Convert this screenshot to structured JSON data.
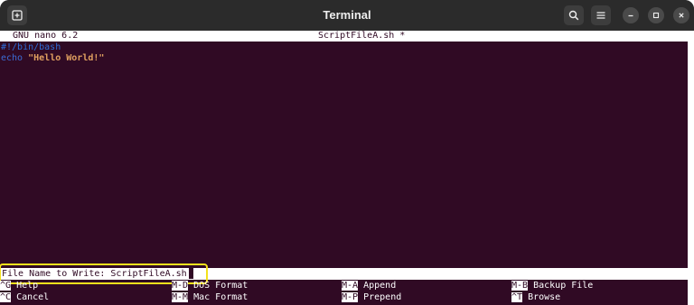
{
  "window": {
    "title": "Terminal"
  },
  "titlebar": {
    "new_tab_icon": "new-tab-icon",
    "search_icon": "search-icon",
    "menu_icon": "hamburger-menu-icon",
    "minimize_icon": "minimize-icon",
    "maximize_icon": "maximize-icon",
    "close_icon": "close-icon"
  },
  "nano": {
    "version": "GNU nano 6.2",
    "filename": "ScriptFileA.sh *",
    "lines": [
      {
        "text": "#!/bin/bash",
        "color": "#2f6ed8"
      },
      {
        "keyword": "echo",
        "keyword_color": "#3c6cd6",
        "string": "\"Hello World!\"",
        "string_color": "#e0a060"
      }
    ],
    "prompt_label": "File Name to Write: ScriptFileA.sh",
    "shortcuts": [
      {
        "key": "^G",
        "label": "Help"
      },
      {
        "key": "M-D",
        "label": "DOS Format"
      },
      {
        "key": "M-A",
        "label": "Append"
      },
      {
        "key": "M-B",
        "label": "Backup File"
      },
      {
        "key": "^C",
        "label": "Cancel"
      },
      {
        "key": "M-M",
        "label": "Mac Format"
      },
      {
        "key": "M-P",
        "label": "Prepend"
      },
      {
        "key": "^T",
        "label": "Browse"
      }
    ]
  },
  "colors": {
    "terminal_bg": "#300a24",
    "titlebar_bg": "#2b2b2b",
    "highlight": "#f4e11c"
  }
}
